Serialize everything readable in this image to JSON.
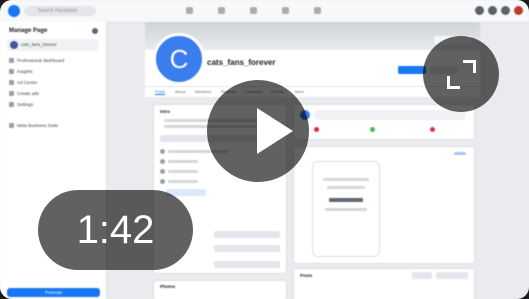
{
  "video": {
    "duration": "1:42",
    "play_icon": "play-icon",
    "expand_icon": "fullscreen-expand-icon"
  },
  "browser": {
    "search_placeholder": "Search Facebook"
  },
  "sidebar": {
    "title": "Manage Page",
    "page_switch": "cats_fans_forever",
    "items": [
      {
        "label": "Professional dashboard"
      },
      {
        "label": "Insights"
      },
      {
        "label": "Ad Center"
      },
      {
        "label": "Create ads"
      },
      {
        "label": "Settings"
      },
      {
        "label": "Meta Business Suite"
      }
    ],
    "promote_label": "Promote"
  },
  "page": {
    "avatar_letter": "C",
    "name": "cats_fans_forever",
    "tabs": [
      {
        "label": "Posts"
      },
      {
        "label": "About"
      },
      {
        "label": "Mentions"
      },
      {
        "label": "Reviews"
      },
      {
        "label": "Followers"
      },
      {
        "label": "Photos"
      },
      {
        "label": "More"
      }
    ]
  },
  "panels": {
    "intro_title": "Intro",
    "photos_title": "Photos",
    "posts_title": "Posts"
  },
  "colors": {
    "accent": "#1877f2",
    "avatar": "#3b7ded",
    "overlay": "rgba(0,0,0,0.62)"
  }
}
